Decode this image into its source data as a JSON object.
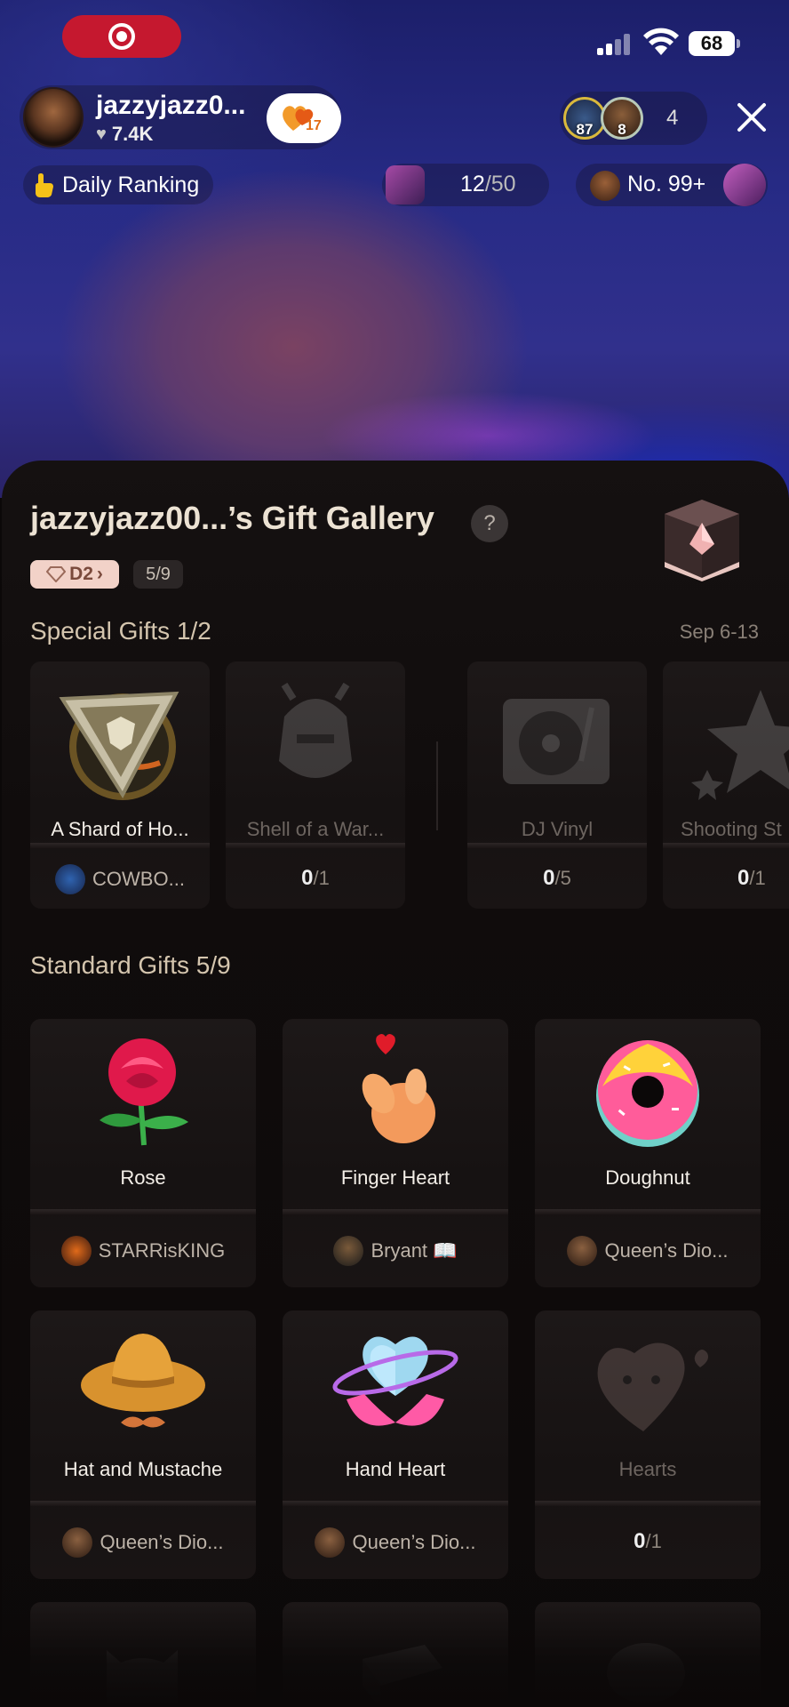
{
  "status_bar": {
    "battery": "68"
  },
  "live": {
    "host_name": "jazzyjazz0...",
    "host_likes": "7.4K",
    "fan_level": "17",
    "viewers": [
      {
        "badge": "87"
      },
      {
        "badge": "8"
      }
    ],
    "viewer_count": "4",
    "daily_ranking_label": "Daily Ranking",
    "goal_current": "12",
    "goal_total": "/50",
    "rank_label": "No. 99+"
  },
  "gallery": {
    "title": "jazzyjazz00...’s Gift Gallery",
    "help_label": "?",
    "tier_label": "D2",
    "tier_progress": "5/9",
    "special": {
      "title": "Special Gifts 1/2",
      "date_range": "Sep 6-13",
      "items": [
        {
          "name": "A Shard of Ho...",
          "icon": "shard-medallion-icon",
          "sender": "COWBO...",
          "state": "unlocked"
        },
        {
          "name": "Shell of a War...",
          "icon": "warrior-helmet-icon",
          "progress": "0",
          "total": "/1",
          "state": "locked"
        },
        {
          "name": "DJ Vinyl",
          "icon": "turntable-icon",
          "progress": "0",
          "total": "/5",
          "state": "locked"
        },
        {
          "name": "Shooting St",
          "icon": "shooting-star-icon",
          "progress": "0",
          "total": "/1",
          "state": "locked"
        }
      ]
    },
    "standard": {
      "title": "Standard Gifts 5/9",
      "items": [
        {
          "name": "Rose",
          "icon": "rose-icon",
          "sender": "STARRisKING",
          "state": "unlocked"
        },
        {
          "name": "Finger Heart",
          "icon": "finger-heart-icon",
          "sender": "Bryant 📖",
          "state": "unlocked"
        },
        {
          "name": "Doughnut",
          "icon": "doughnut-icon",
          "sender": "Queen’s Dio...",
          "state": "unlocked"
        },
        {
          "name": "Hat and Mustache",
          "icon": "hat-mustache-icon",
          "sender": "Queen’s Dio...",
          "state": "unlocked"
        },
        {
          "name": "Hand Heart",
          "icon": "hand-heart-icon",
          "sender": "Queen’s Dio...",
          "state": "unlocked"
        },
        {
          "name": "Hearts",
          "icon": "hearts-icon",
          "progress": "0",
          "total": "/1",
          "state": "locked"
        }
      ]
    }
  }
}
